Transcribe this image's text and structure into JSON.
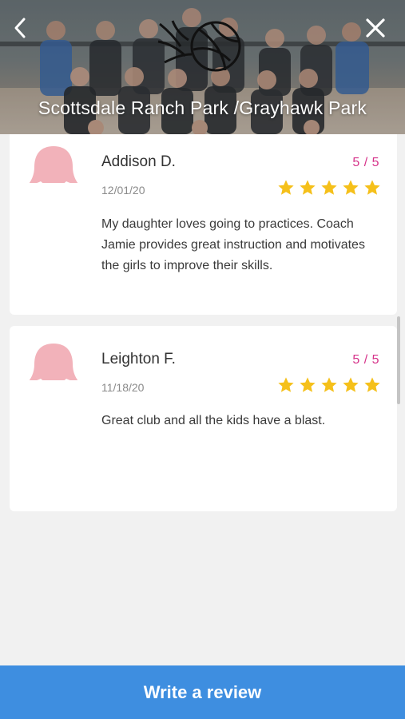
{
  "header": {
    "title": "Scottsdale Ranch Park /Grayhawk Park",
    "back_icon": "chevron-left-icon",
    "close_icon": "close-icon",
    "logo": "volleyball-logo"
  },
  "reviews": [
    {
      "name": "Addison D.",
      "date": "12/01/20",
      "rating_text": "5 / 5",
      "rating": 5,
      "text": "My daughter loves going to practices. Coach Jamie provides great instruction and motivates the girls to improve their skills."
    },
    {
      "name": "Leighton F.",
      "date": "11/18/20",
      "rating_text": "5 / 5",
      "rating": 5,
      "text": "Great club and all the kids have a blast."
    }
  ],
  "footer": {
    "write_review_label": "Write a review"
  },
  "colors": {
    "accent": "#3e8ee0",
    "rating": "#d6338a",
    "star": "#f5c01a",
    "avatar": "#f0a9b3"
  }
}
